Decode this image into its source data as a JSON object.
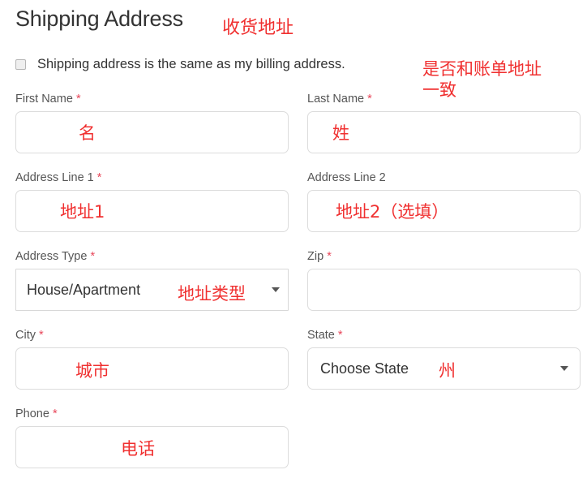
{
  "header": {
    "title": "Shipping Address",
    "title_annotation": "收货地址"
  },
  "billing_checkbox": {
    "label": "Shipping address is the same as my billing address.",
    "checked": false,
    "annotation": "是否和账单地址\n一致"
  },
  "fields": {
    "first_name": {
      "label": "First Name",
      "required_mark": "*",
      "value": "",
      "annotation": "名"
    },
    "last_name": {
      "label": "Last Name",
      "required_mark": "*",
      "value": "",
      "annotation": "姓"
    },
    "address_line_1": {
      "label": "Address Line 1",
      "required_mark": "*",
      "value": "",
      "annotation": "地址1"
    },
    "address_line_2": {
      "label": "Address Line 2",
      "required_mark": "",
      "value": "",
      "annotation": "地址2（选填）"
    },
    "address_type": {
      "label": "Address Type",
      "required_mark": "*",
      "selected": "House/Apartment",
      "annotation": "地址类型"
    },
    "zip": {
      "label": "Zip",
      "required_mark": "*",
      "value": "",
      "annotation": ""
    },
    "city": {
      "label": "City",
      "required_mark": "*",
      "value": "",
      "annotation": "城市"
    },
    "state": {
      "label": "State",
      "required_mark": "*",
      "selected": "Choose State",
      "annotation": "州"
    },
    "phone": {
      "label": "Phone",
      "required_mark": "*",
      "value": "",
      "annotation": "电话"
    }
  },
  "colors": {
    "annotation_red": "#f03030",
    "required_red": "#e8475a",
    "text_dark": "#333333",
    "label_gray": "#555555",
    "border_gray": "#dcdcdc"
  }
}
